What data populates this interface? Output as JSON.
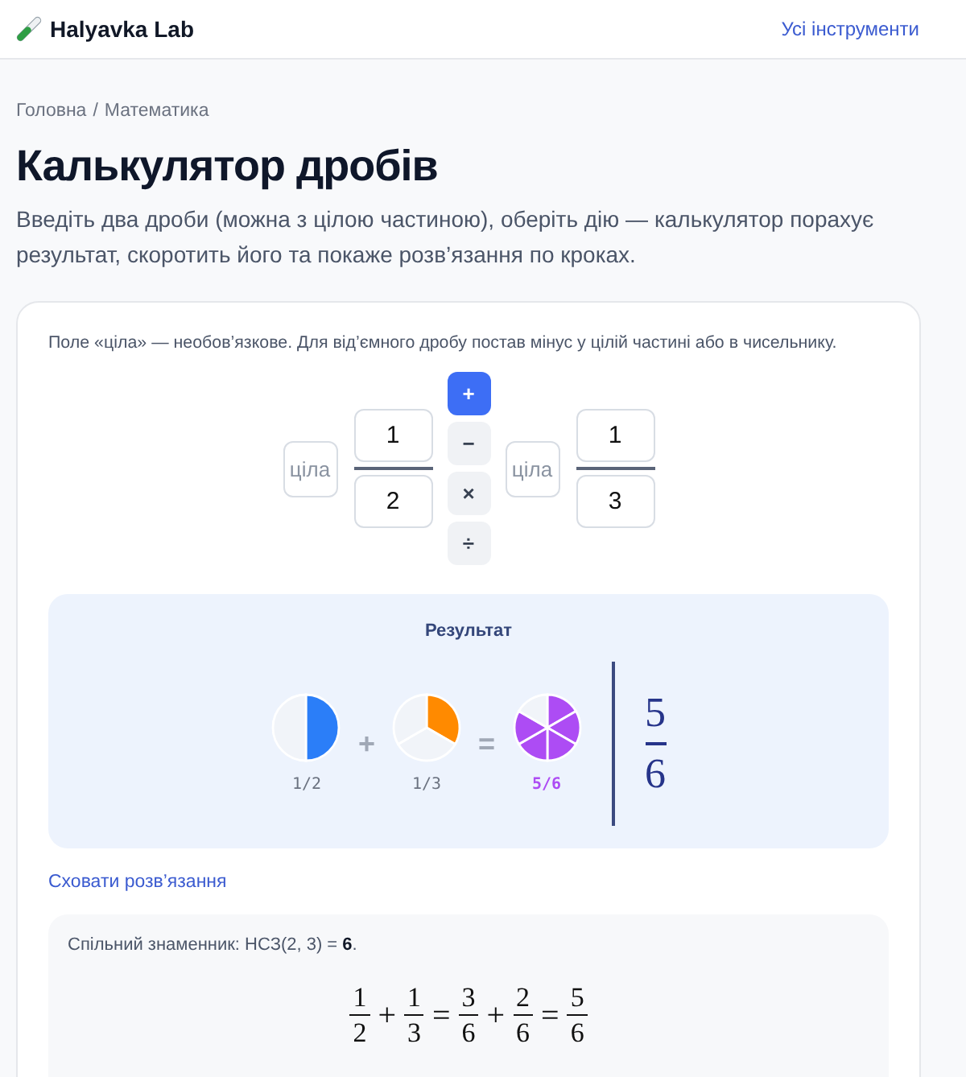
{
  "header": {
    "brand": "Halyavka Lab",
    "link": "Усі інструменти"
  },
  "breadcrumb": {
    "items": [
      "Головна",
      "Математика"
    ],
    "separator": "/"
  },
  "title": "Калькулятор дробів",
  "description": "Введіть два дроби (можна з цілою частиною), оберіть дію — калькулятор порахує результат, скоротить його та покаже розв’язання по кроках.",
  "calculator": {
    "hint": "Поле «ціла» — необов’язкове. Для від’ємного дробу постав мінус у цілій частині або в чисельнику.",
    "operands": [
      {
        "whole_placeholder": "ціла",
        "numerator": "1",
        "denominator": "2"
      },
      {
        "whole_placeholder": "ціла",
        "numerator": "1",
        "denominator": "3"
      }
    ],
    "operations": [
      {
        "label": "+",
        "selected": true
      },
      {
        "label": "−",
        "selected": false
      },
      {
        "label": "×",
        "selected": false
      },
      {
        "label": "÷",
        "selected": false
      }
    ]
  },
  "result": {
    "title": "Результат",
    "items": [
      {
        "kind": "pie",
        "color": "#2b7ef8",
        "label": "1/2",
        "highlighted": false
      },
      {
        "kind": "operator",
        "symbol": "+"
      },
      {
        "kind": "pie",
        "color": "#ff8a00",
        "label": "1/3",
        "highlighted": false
      },
      {
        "kind": "operator",
        "symbol": "="
      },
      {
        "kind": "pie",
        "color": "#ad4cf4",
        "label": "5/6",
        "highlighted": true
      }
    ],
    "answer": {
      "numerator": "5",
      "denominator": "6"
    }
  },
  "solution": {
    "toggle": "Сховати розв’язання",
    "steps": [
      {
        "kind": "text",
        "text": "Спільний знаменник: НСЗ(2, 3) = **6**."
      },
      {
        "kind": "equation",
        "terms": [
          {
            "kind": "fraction",
            "numerator": "1",
            "denominator": "2"
          },
          {
            "kind": "operator",
            "symbol": "+"
          },
          {
            "kind": "fraction",
            "numerator": "1",
            "denominator": "3"
          },
          {
            "kind": "operator",
            "symbol": "="
          },
          {
            "kind": "fraction",
            "numerator": "3",
            "denominator": "6"
          },
          {
            "kind": "operator",
            "symbol": "+"
          },
          {
            "kind": "fraction",
            "numerator": "2",
            "denominator": "6"
          },
          {
            "kind": "operator",
            "symbol": "="
          },
          {
            "kind": "fraction",
            "numerator": "5",
            "denominator": "6"
          }
        ]
      }
    ]
  }
}
